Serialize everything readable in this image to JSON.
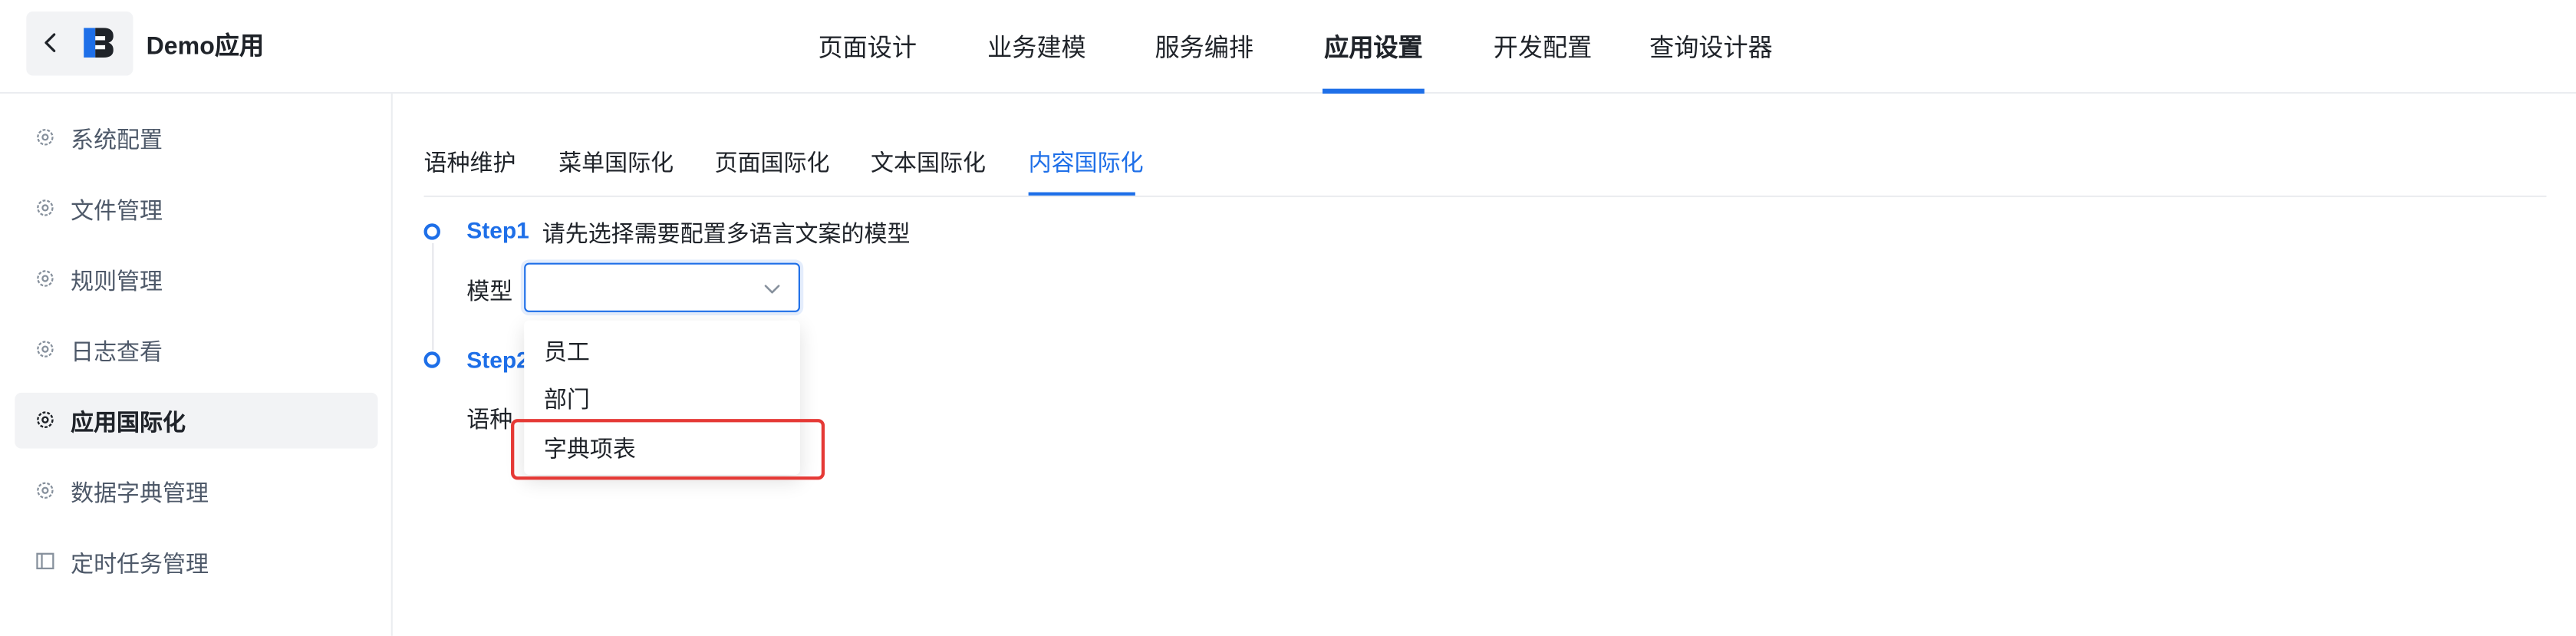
{
  "header": {
    "app_name": "Demo应用",
    "tabs": [
      {
        "label": "页面设计"
      },
      {
        "label": "业务建模"
      },
      {
        "label": "服务编排"
      },
      {
        "label": "应用设置"
      },
      {
        "label": "开发配置"
      },
      {
        "label": "查询设计器"
      }
    ],
    "active_tab": "应用设置",
    "accent_color": "#1e6fe8"
  },
  "sidebar": {
    "items": [
      {
        "label": "系统配置",
        "icon": "gear-icon"
      },
      {
        "label": "文件管理",
        "icon": "gear-icon"
      },
      {
        "label": "规则管理",
        "icon": "gear-icon"
      },
      {
        "label": "日志查看",
        "icon": "gear-icon"
      },
      {
        "label": "应用国际化",
        "icon": "gear-icon"
      },
      {
        "label": "数据字典管理",
        "icon": "gear-icon"
      },
      {
        "label": "定时任务管理",
        "icon": "table-icon"
      }
    ],
    "active_item": "应用国际化"
  },
  "subtabs": {
    "items": [
      {
        "label": "语种维护"
      },
      {
        "label": "菜单国际化"
      },
      {
        "label": "页面国际化"
      },
      {
        "label": "文本国际化"
      },
      {
        "label": "内容国际化"
      }
    ],
    "active": "内容国际化"
  },
  "steps": {
    "step1": {
      "title": "Step1",
      "description": "请先选择需要配置多语言文案的模型"
    },
    "step2": {
      "title": "Step2"
    }
  },
  "form": {
    "model_label": "模型",
    "model_value": "",
    "language_label": "语种"
  },
  "dropdown": {
    "options": [
      {
        "label": "员工"
      },
      {
        "label": "部门"
      },
      {
        "label": "字典项表"
      }
    ],
    "highlighted": "字典项表",
    "highlight_color": "#e53935"
  }
}
